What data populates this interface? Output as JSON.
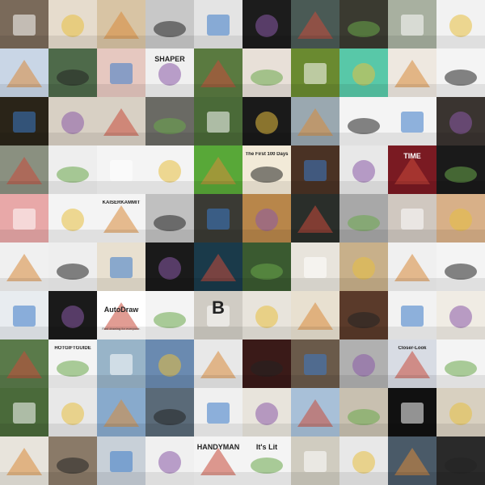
{
  "grid": {
    "columns": 10,
    "rows": 10
  },
  "tiles": [
    {
      "name": "tile-robot-desk",
      "bg": "#7a6a5a"
    },
    {
      "name": "tile-wood-chair",
      "bg": "#e6dccd"
    },
    {
      "name": "tile-wood-floor",
      "bg": "#d8c4a4"
    },
    {
      "name": "tile-speaker-hand",
      "bg": "#c8c8c8"
    },
    {
      "name": "tile-black-device",
      "bg": "#e4e4e4"
    },
    {
      "name": "tile-gear-clock",
      "bg": "#1c1c1c"
    },
    {
      "name": "tile-green-gadget",
      "bg": "#4a5a55"
    },
    {
      "name": "tile-dark-room",
      "bg": "#3a3a30"
    },
    {
      "name": "tile-cabin",
      "bg": "#a8b0a0"
    },
    {
      "name": "tile-red-toaster",
      "bg": "#f2f2f2"
    },
    {
      "name": "tile-eye",
      "bg": "#c9d6e6"
    },
    {
      "name": "tile-landscape",
      "bg": "#4e6a4a"
    },
    {
      "name": "tile-lingerie",
      "bg": "#e6c8c0"
    },
    {
      "name": "tile-espresso-machine",
      "bg": "#f0f0f0",
      "text": "SHAPER"
    },
    {
      "name": "tile-treehouse",
      "bg": "#5a7a40"
    },
    {
      "name": "tile-shelves",
      "bg": "#e8e0d8"
    },
    {
      "name": "tile-garden",
      "bg": "#6a8a30"
    },
    {
      "name": "tile-teal-frame",
      "bg": "#58c8a8"
    },
    {
      "name": "tile-hand-device",
      "bg": "#eee8e0"
    },
    {
      "name": "tile-green-box",
      "bg": "#f4f4f4"
    },
    {
      "name": "tile-gold-jewel",
      "bg": "#2a2418"
    },
    {
      "name": "tile-light-bulbs",
      "bg": "#d8d0c4"
    },
    {
      "name": "tile-sneaker",
      "bg": "#d8d0c4"
    },
    {
      "name": "tile-orange-tent",
      "bg": "#6a6a64"
    },
    {
      "name": "tile-green-house",
      "bg": "#4a6a38"
    },
    {
      "name": "tile-dark-tray",
      "bg": "#1a1a1a"
    },
    {
      "name": "tile-aerial-city",
      "bg": "#9aa8b0"
    },
    {
      "name": "tile-icon-chart",
      "bg": "#f4f4f4"
    },
    {
      "name": "tile-car-grid",
      "bg": "#f4f4f4"
    },
    {
      "name": "tile-ice-cream",
      "bg": "#3a3430"
    },
    {
      "name": "tile-modern-house",
      "bg": "#8a9080"
    },
    {
      "name": "tile-monitor-hand",
      "bg": "#eeeeee"
    },
    {
      "name": "tile-lego-box",
      "bg": "#f4f4f4"
    },
    {
      "name": "tile-yellow-vase",
      "bg": "#f4f4f4"
    },
    {
      "name": "tile-green-poster",
      "bg": "#58a838"
    },
    {
      "name": "tile-first-100-days",
      "bg": "#f2ead8",
      "text": "The First 100 Days"
    },
    {
      "name": "tile-leather-bag",
      "bg": "#4a3224"
    },
    {
      "name": "tile-chair-person",
      "bg": "#e8e8e8"
    },
    {
      "name": "tile-time-cover",
      "bg": "#7a1a22",
      "text": "TIME"
    },
    {
      "name": "tile-blue-swirl",
      "bg": "#1a1a1a"
    },
    {
      "name": "tile-pink-wall",
      "bg": "#e8a8a8"
    },
    {
      "name": "tile-robot-arm",
      "bg": "#f4f4f4"
    },
    {
      "name": "tile-kaiserkammit",
      "bg": "#f4f4f4",
      "text": "KAISERKAMMIT"
    },
    {
      "name": "tile-white-blob",
      "bg": "#c0c0c0"
    },
    {
      "name": "tile-man-laptop",
      "bg": "#3a3a34"
    },
    {
      "name": "tile-golden-cave",
      "bg": "#b8864a"
    },
    {
      "name": "tile-green-lantern",
      "bg": "#2a2e2a"
    },
    {
      "name": "tile-puzzle-machine",
      "bg": "#a8a8a8"
    },
    {
      "name": "tile-round-table",
      "bg": "#d0c8c0"
    },
    {
      "name": "tile-origami-birds",
      "bg": "#d8b088"
    },
    {
      "name": "tile-white-frame",
      "bg": "#f0f0f0"
    },
    {
      "name": "tile-spiral-tool",
      "bg": "#eeeeee"
    },
    {
      "name": "tile-wood-hinge",
      "bg": "#e8e0d0"
    },
    {
      "name": "tile-fire-pit",
      "bg": "#1a1a1a"
    },
    {
      "name": "tile-blue-figure",
      "bg": "#1a3a4a"
    },
    {
      "name": "tile-green-box-2",
      "bg": "#3a5a30"
    },
    {
      "name": "tile-cards",
      "bg": "#e8e4dc"
    },
    {
      "name": "tile-ruler-wood",
      "bg": "#c8b08a"
    },
    {
      "name": "tile-pour-cups",
      "bg": "#f0f0f0"
    },
    {
      "name": "tile-clock-shelf",
      "bg": "#f4f4f4"
    },
    {
      "name": "tile-blue-shirt",
      "bg": "#e8ecf0"
    },
    {
      "name": "tile-string-art",
      "bg": "#1a1a1a"
    },
    {
      "name": "tile-autodraw",
      "bg": "#ffffff",
      "text": "AutoDraw",
      "subtext": "Fast drawing for everyone."
    },
    {
      "name": "tile-guns",
      "bg": "#f4f4f4"
    },
    {
      "name": "tile-b-sign",
      "bg": "#d0ccc4",
      "text": "B"
    },
    {
      "name": "tile-pineapple",
      "bg": "#e8e4dc"
    },
    {
      "name": "tile-light-room",
      "bg": "#e8e0d0"
    },
    {
      "name": "tile-red-printer",
      "bg": "#5a3a2a"
    },
    {
      "name": "tile-red-cylinder",
      "bg": "#f2f2f2"
    },
    {
      "name": "tile-gramophone",
      "bg": "#f0ece4"
    },
    {
      "name": "tile-dome",
      "bg": "#5a7a4a"
    },
    {
      "name": "tile-gift-guide",
      "bg": "#f4f4f4",
      "text": "HOTGIFTGUIDE"
    },
    {
      "name": "tile-bridge",
      "bg": "#98b4c8"
    },
    {
      "name": "tile-snow-cabin",
      "bg": "#6a8ab0"
    },
    {
      "name": "tile-greenhouse",
      "bg": "#e8e8e8"
    },
    {
      "name": "tile-dark-cabinet",
      "bg": "#3a1a18"
    },
    {
      "name": "tile-ping-pong",
      "bg": "#6a5a4a"
    },
    {
      "name": "tile-silver-car",
      "bg": "#b0b0b0"
    },
    {
      "name": "tile-headline",
      "bg": "#d8dce4",
      "text": "Closer-Look"
    },
    {
      "name": "tile-moose",
      "bg": "#f4f4f4"
    },
    {
      "name": "tile-blue-car",
      "bg": "#4a6a3a"
    },
    {
      "name": "tile-leggings",
      "bg": "#e8e8e8"
    },
    {
      "name": "tile-red-truck",
      "bg": "#88aacc"
    },
    {
      "name": "tile-boots",
      "bg": "#5a6a78"
    },
    {
      "name": "tile-black-car",
      "bg": "#f0f0f0"
    },
    {
      "name": "tile-carrots",
      "bg": "#e8e4dc"
    },
    {
      "name": "tile-planes",
      "bg": "#a8c0d8"
    },
    {
      "name": "tile-elephant",
      "bg": "#c8c0b0"
    },
    {
      "name": "tile-dark-doorway",
      "bg": "#111111"
    },
    {
      "name": "tile-retro-mac",
      "bg": "#d8d0c0"
    },
    {
      "name": "tile-white-chair",
      "bg": "#e8e4dc"
    },
    {
      "name": "tile-stone-room",
      "bg": "#8a7a68"
    },
    {
      "name": "tile-white-box",
      "bg": "#c8d0d8"
    },
    {
      "name": "tile-two-people",
      "bg": "#f0f0f0"
    },
    {
      "name": "tile-handyman",
      "bg": "#f4f4f4",
      "text": "HANDYMAN"
    },
    {
      "name": "tile-lit-book",
      "bg": "#f4f4f4",
      "text": "It's Lit"
    },
    {
      "name": "tile-jeep",
      "bg": "#d0ccc0"
    },
    {
      "name": "tile-colored-figures",
      "bg": "#e8e8e8"
    },
    {
      "name": "tile-pattern",
      "bg": "#4a5a68"
    },
    {
      "name": "tile-blue-vase",
      "bg": "#2a2a2a"
    }
  ]
}
